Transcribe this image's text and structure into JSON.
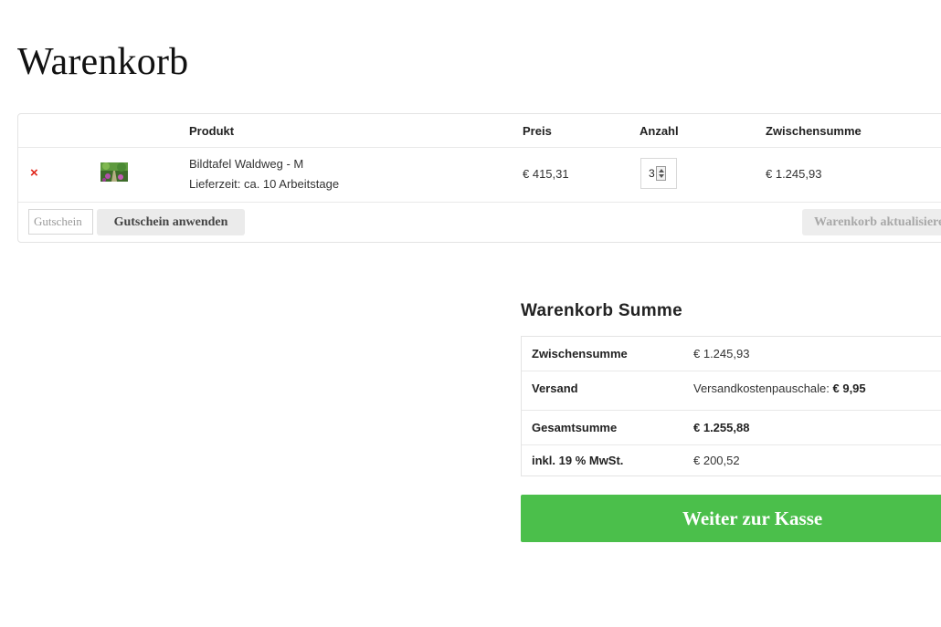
{
  "page": {
    "title": "Warenkorb"
  },
  "cart": {
    "headers": {
      "product": "Produkt",
      "price": "Preis",
      "quantity": "Anzahl",
      "subtotal": "Zwischensumme"
    },
    "items": [
      {
        "remove_icon": "×",
        "thumbnail_icon": "forest-path-image",
        "name": "Bildtafel Waldweg - M",
        "delivery": "Lieferzeit: ca. 10 Arbeitstage",
        "price": "€ 415,31",
        "quantity": "3",
        "subtotal": "€ 1.245,93"
      }
    ],
    "coupon_placeholder": "Gutschein",
    "apply_coupon_label": "Gutschein anwenden",
    "update_cart_label": "Warenkorb aktualisieren"
  },
  "totals": {
    "title": "Warenkorb Summe",
    "rows": [
      {
        "label": "Zwischensumme",
        "value": "€ 1.245,93"
      },
      {
        "label": "Versand",
        "value_prefix": "Versandkostenpauschale: ",
        "value_bold": "€ 9,95"
      },
      {
        "label": "Gesamtsumme",
        "value": "€ 1.255,88"
      },
      {
        "label": "inkl. 19 % MwSt.",
        "value": "€ 200,52"
      }
    ]
  },
  "checkout_label": "Weiter zur Kasse",
  "colors": {
    "accent_green": "#4bbf4b",
    "remove_red": "#e0261b"
  }
}
